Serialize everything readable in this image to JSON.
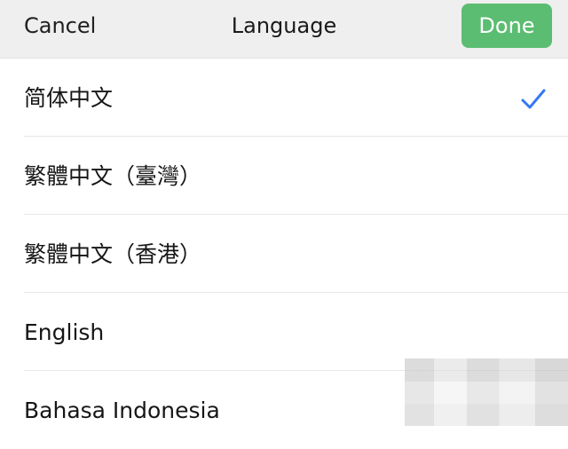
{
  "header": {
    "cancel_label": "Cancel",
    "title": "Language",
    "done_label": "Done"
  },
  "languages": [
    {
      "label": "简体中文",
      "selected": true
    },
    {
      "label": "繁體中文（臺灣）",
      "selected": false
    },
    {
      "label": "繁體中文（香港）",
      "selected": false
    },
    {
      "label": "English",
      "selected": false
    },
    {
      "label": "Bahasa Indonesia",
      "selected": false
    }
  ],
  "colors": {
    "accent": "#3478f6",
    "done_background": "#5bbd71",
    "header_background": "#efefef"
  },
  "icons": {
    "selected_marker": "checkmark-icon"
  }
}
